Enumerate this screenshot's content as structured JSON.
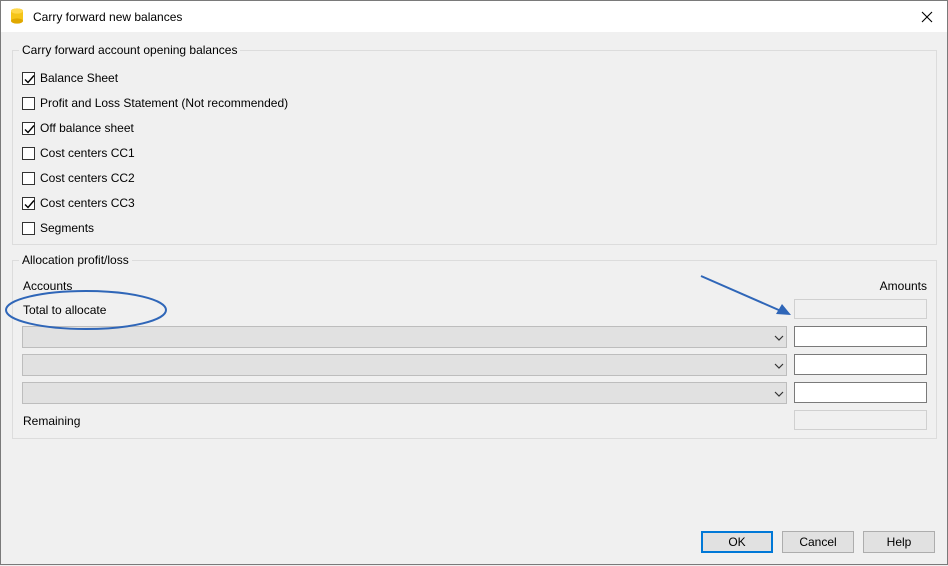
{
  "window": {
    "title": "Carry forward new balances",
    "icon": "database-icon",
    "close_icon": "close-icon"
  },
  "opening_balances": {
    "legend": "Carry forward account opening balances",
    "options": [
      {
        "label": "Balance Sheet",
        "checked": true
      },
      {
        "label": "Profit and Loss Statement (Not recommended)",
        "checked": false
      },
      {
        "label": "Off balance sheet",
        "checked": true
      },
      {
        "label": "Cost centers CC1",
        "checked": false
      },
      {
        "label": "Cost centers CC2",
        "checked": false
      },
      {
        "label": "Cost centers CC3",
        "checked": true
      },
      {
        "label": "Segments",
        "checked": false
      }
    ]
  },
  "allocation": {
    "legend": "Allocation profit/loss",
    "accounts_header": "Accounts",
    "amounts_header": "Amounts",
    "total_label": "Total to allocate",
    "total_value": "",
    "rows": [
      {
        "account": "",
        "amount": ""
      },
      {
        "account": "",
        "amount": ""
      },
      {
        "account": "",
        "amount": ""
      }
    ],
    "remaining_label": "Remaining",
    "remaining_value": ""
  },
  "buttons": {
    "ok": "OK",
    "cancel": "Cancel",
    "help": "Help"
  },
  "colors": {
    "annotation": "#2f66b8",
    "default_button_border": "#0078d7",
    "app_icon": "#f5c518"
  }
}
